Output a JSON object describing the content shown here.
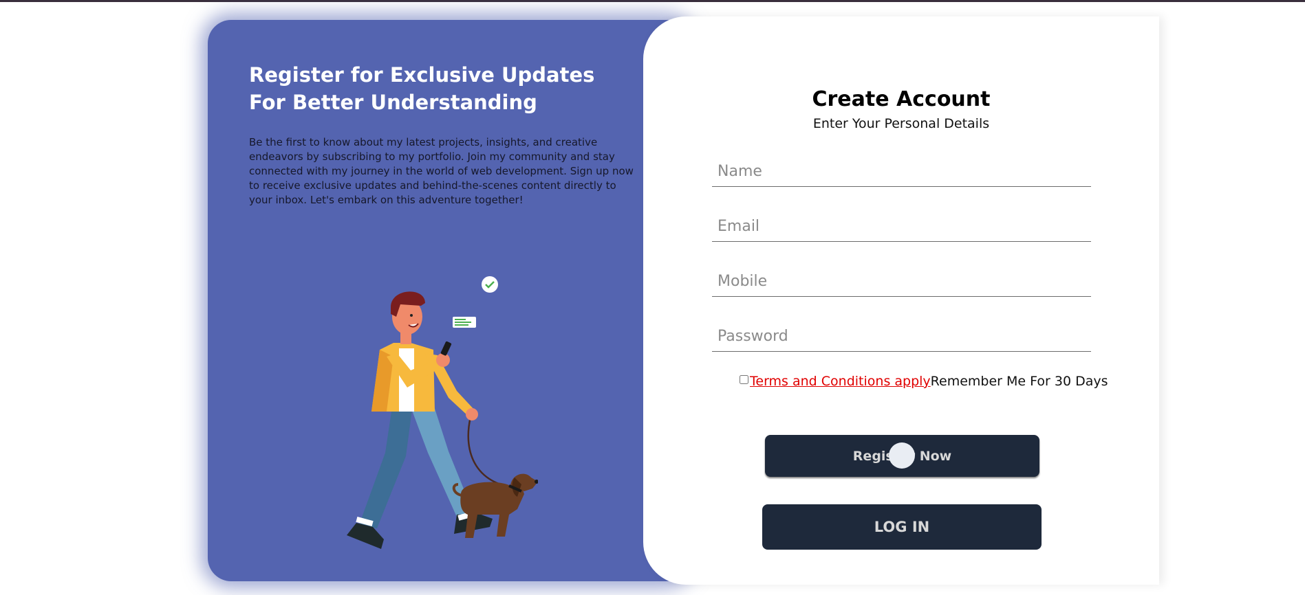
{
  "promo": {
    "title": "Register for Exclusive Updates For Better Understanding",
    "description": "Be the first to know about my latest projects, insights, and creative endeavors by subscribing to my portfolio. Join my community and stay connected with my journey in the world of web development. Sign up now to receive exclusive updates and behind-the-scenes content directly to your inbox. Let's embark on this adventure together!",
    "illustration_icon": "man-walking-dog-illustration"
  },
  "form": {
    "title": "Create Account",
    "subtitle": "Enter Your Personal Details",
    "fields": {
      "name": {
        "placeholder": "Name",
        "value": ""
      },
      "email": {
        "placeholder": "Email",
        "value": ""
      },
      "mobile": {
        "placeholder": "Mobile",
        "value": ""
      },
      "password": {
        "placeholder": "Password",
        "value": ""
      }
    },
    "terms_link": " Terms and Conditions apply ",
    "remember_label": "Remember Me For 30 Days",
    "remember_checked": false,
    "register_button": "Register Now",
    "login_button": "LOG IN"
  },
  "colors": {
    "promo_background": "#5464b0",
    "button_background": "#1e293b",
    "terms_link": "#e00000"
  }
}
